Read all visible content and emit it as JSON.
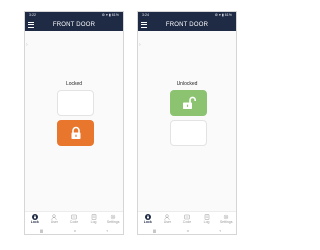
{
  "screens": [
    {
      "status": {
        "time": "3:22",
        "icons": "⚙ ▾ ▮ 61%"
      },
      "title": "FRONT DOOR",
      "lock_label": "Locked",
      "state": "locked",
      "tabs": [
        {
          "label": "Lock",
          "icon": "lock-icon",
          "active": true
        },
        {
          "label": "User",
          "icon": "user-icon",
          "active": false
        },
        {
          "label": "Code",
          "icon": "code-icon",
          "active": false
        },
        {
          "label": "Log",
          "icon": "log-icon",
          "active": false
        },
        {
          "label": "Settings",
          "icon": "gear-icon",
          "active": false
        }
      ]
    },
    {
      "status": {
        "time": "3:24",
        "icons": "⚙ ▾ ▮ 61%"
      },
      "title": "FRONT DOOR",
      "lock_label": "Unlocked",
      "state": "unlocked",
      "tabs": [
        {
          "label": "Lock",
          "icon": "lock-icon",
          "active": true
        },
        {
          "label": "User",
          "icon": "user-icon",
          "active": false
        },
        {
          "label": "Code",
          "icon": "code-icon",
          "active": false
        },
        {
          "label": "Log",
          "icon": "log-icon",
          "active": false
        },
        {
          "label": "Settings",
          "icon": "gear-icon",
          "active": false
        }
      ]
    }
  ],
  "nav_glyphs": {
    "recent": "|||",
    "home": "○",
    "back": "‹"
  },
  "colors": {
    "appbar": "#1f2b45",
    "locked": "#e8772d",
    "unlocked": "#8bc370"
  }
}
